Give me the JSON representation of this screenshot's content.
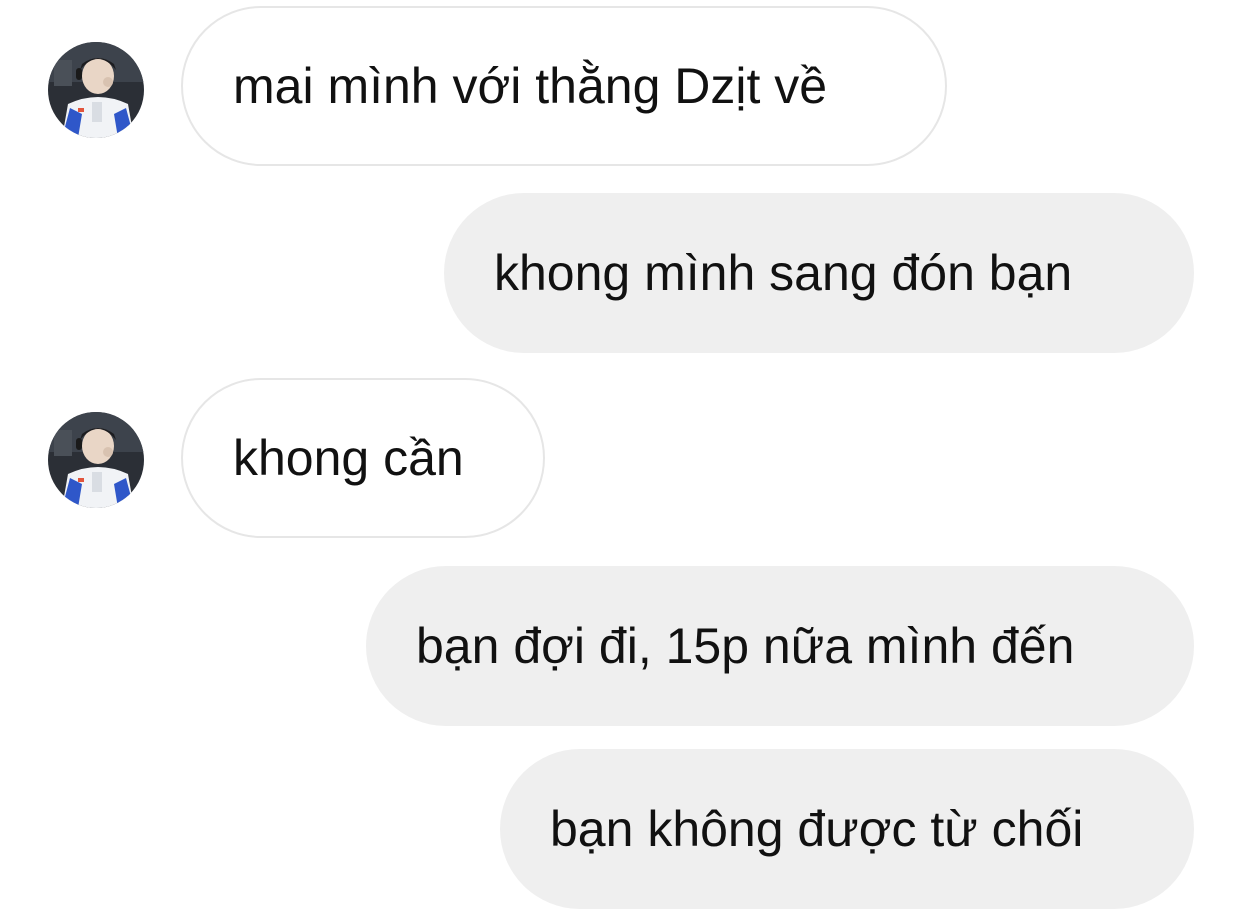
{
  "conversation": {
    "messages": [
      {
        "sender": "other",
        "text": "mai mình với thằng Dzịt về",
        "avatar": "profile-photo"
      },
      {
        "sender": "me",
        "text": "khong mình sang đón bạn"
      },
      {
        "sender": "other",
        "text": "khong cần",
        "avatar": "profile-photo"
      },
      {
        "sender": "me",
        "text": "bạn đợi đi, 15p nữa mình đến"
      },
      {
        "sender": "me",
        "text": "bạn không được từ chối"
      }
    ]
  },
  "colors": {
    "incoming_bubble_bg": "#ffffff",
    "incoming_bubble_border": "#e6e6e6",
    "outgoing_bubble_bg": "#efefef",
    "text": "#111111"
  }
}
